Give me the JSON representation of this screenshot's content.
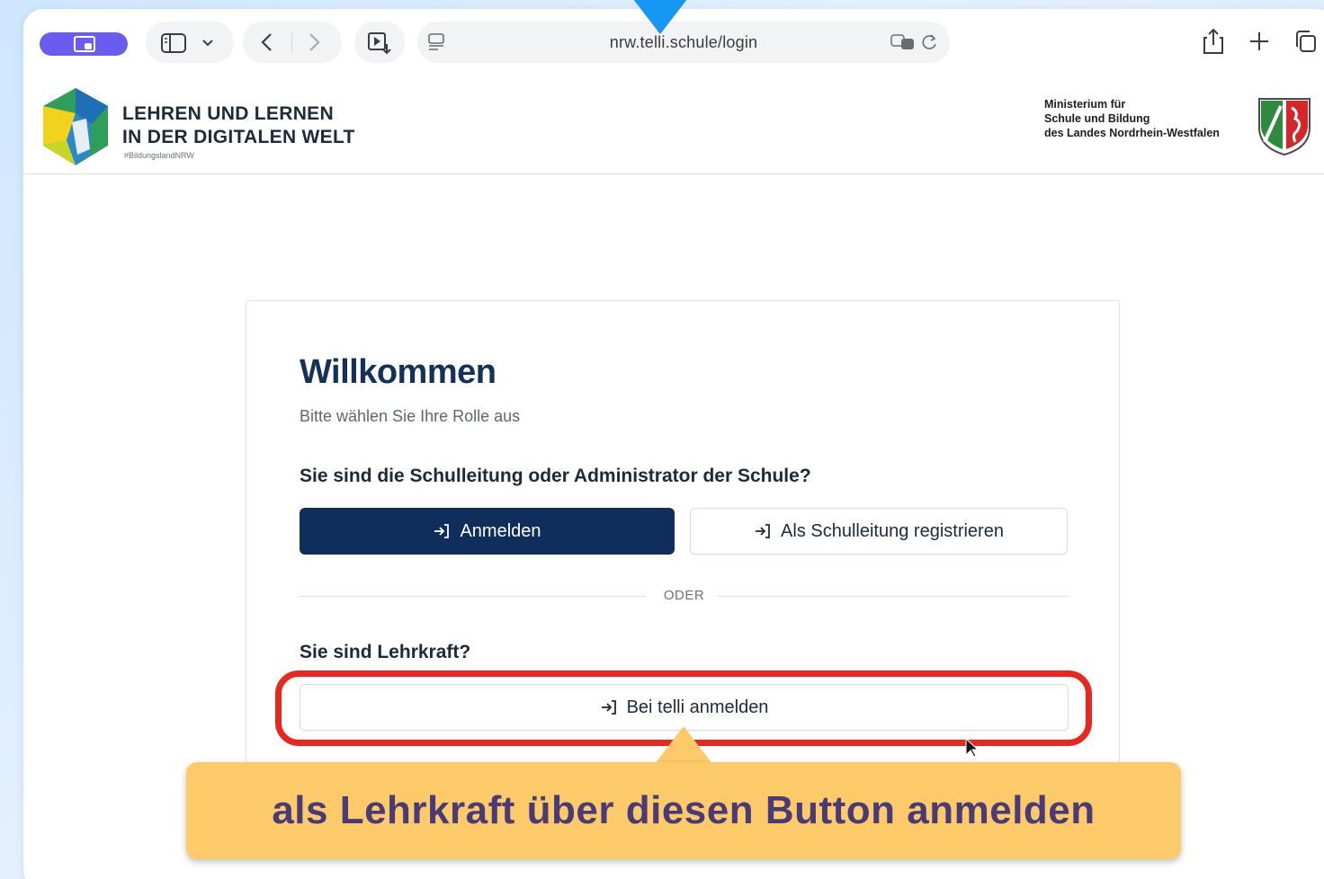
{
  "browser": {
    "url": "nrw.telli.schule/login"
  },
  "site": {
    "brand_line1": "LEHREN UND LERNEN",
    "brand_line2": "IN DER DIGITALEN WELT",
    "brand_tag": "#BildungslandNRW",
    "ministry_line1": "Ministerium für",
    "ministry_line2": "Schule und Bildung",
    "ministry_line3": "des Landes Nordrhein-Westfalen"
  },
  "login": {
    "title": "Willkommen",
    "subtitle": "Bitte wählen Sie Ihre Rolle aus",
    "admin_question": "Sie sind die Schulleitung oder Administrator der Schule?",
    "login_button": "Anmelden",
    "register_button": "Als Schulleitung registrieren",
    "divider": "ODER",
    "teacher_question": "Sie sind Lehrkraft?",
    "teacher_button": "Bei telli anmelden"
  },
  "annotation": {
    "callout_text": "als Lehrkraft über diesen Button anmelden"
  },
  "colors": {
    "primary": "#0f2e5c",
    "highlight": "#e8281f",
    "callout_bg": "#fdca6a",
    "callout_text": "#4b3a78",
    "pointer": "#1597f4"
  }
}
